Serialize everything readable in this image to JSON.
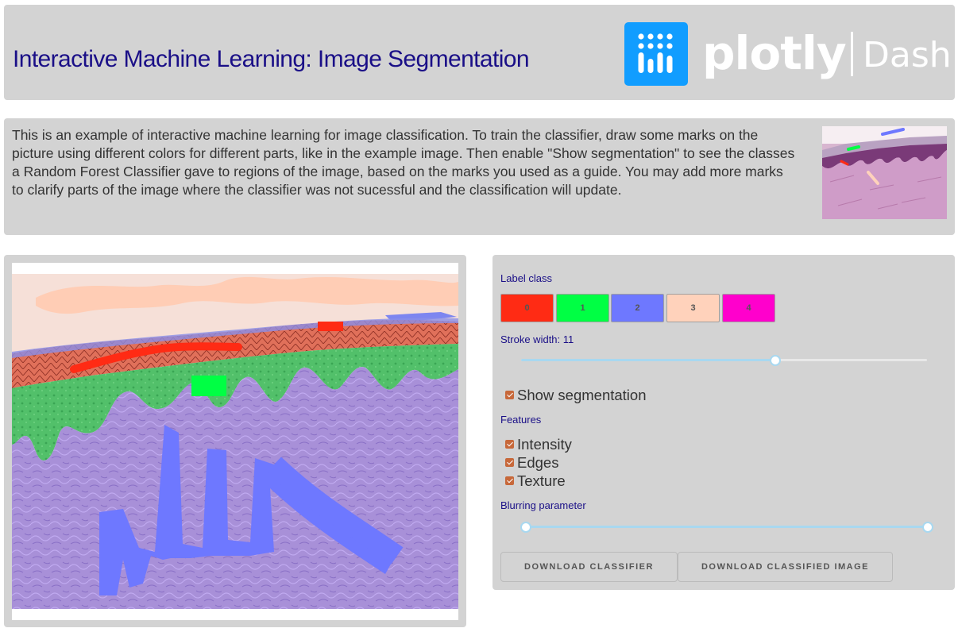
{
  "header": {
    "title": "Interactive Machine Learning: Image Segmentation",
    "logo": {
      "wordmark": "plotly",
      "product": "Dash",
      "icon": "plotly-logo-icon"
    }
  },
  "intro": {
    "text": "This is an example of interactive machine learning for image classification. To train the classifier, draw some marks on the picture using different colors for different parts, like in the example image. Then enable \"Show segmentation\" to see the classes a Random Forest Classifier gave to regions of the image, based on the marks you used as a guide. You may add more marks to clarify parts of the image where the classifier was not sucessful and the classification will update."
  },
  "controls": {
    "label_class": {
      "title": "Label class",
      "classes": [
        {
          "label": "0",
          "color": "#ff2b14"
        },
        {
          "label": "1",
          "color": "#00ff44"
        },
        {
          "label": "2",
          "color": "#6e78ff"
        },
        {
          "label": "3",
          "color": "#ffd2bb"
        },
        {
          "label": "4",
          "color": "#ff00cc"
        }
      ]
    },
    "stroke_width": {
      "label": "Stroke width: 11",
      "value": 11,
      "min": 1,
      "max": 17
    },
    "show_segmentation": {
      "label": "Show segmentation",
      "checked": true
    },
    "features": {
      "title": "Features",
      "options": [
        {
          "label": "Intensity",
          "checked": true
        },
        {
          "label": "Edges",
          "checked": true
        },
        {
          "label": "Texture",
          "checked": true
        }
      ]
    },
    "blurring": {
      "label": "Blurring parameter",
      "range": [
        0,
        1
      ]
    },
    "buttons": {
      "download_classifier": "DOWNLOAD CLASSIFIER",
      "download_image": "DOWNLOAD CLASSIFIED IMAGE"
    }
  },
  "colors": {
    "card_bg": "#d3d3d3",
    "title": "#1a0f87",
    "logo_blue": "#119dff",
    "slider": "#a8d8f0",
    "checkbox": "#c7683a"
  }
}
